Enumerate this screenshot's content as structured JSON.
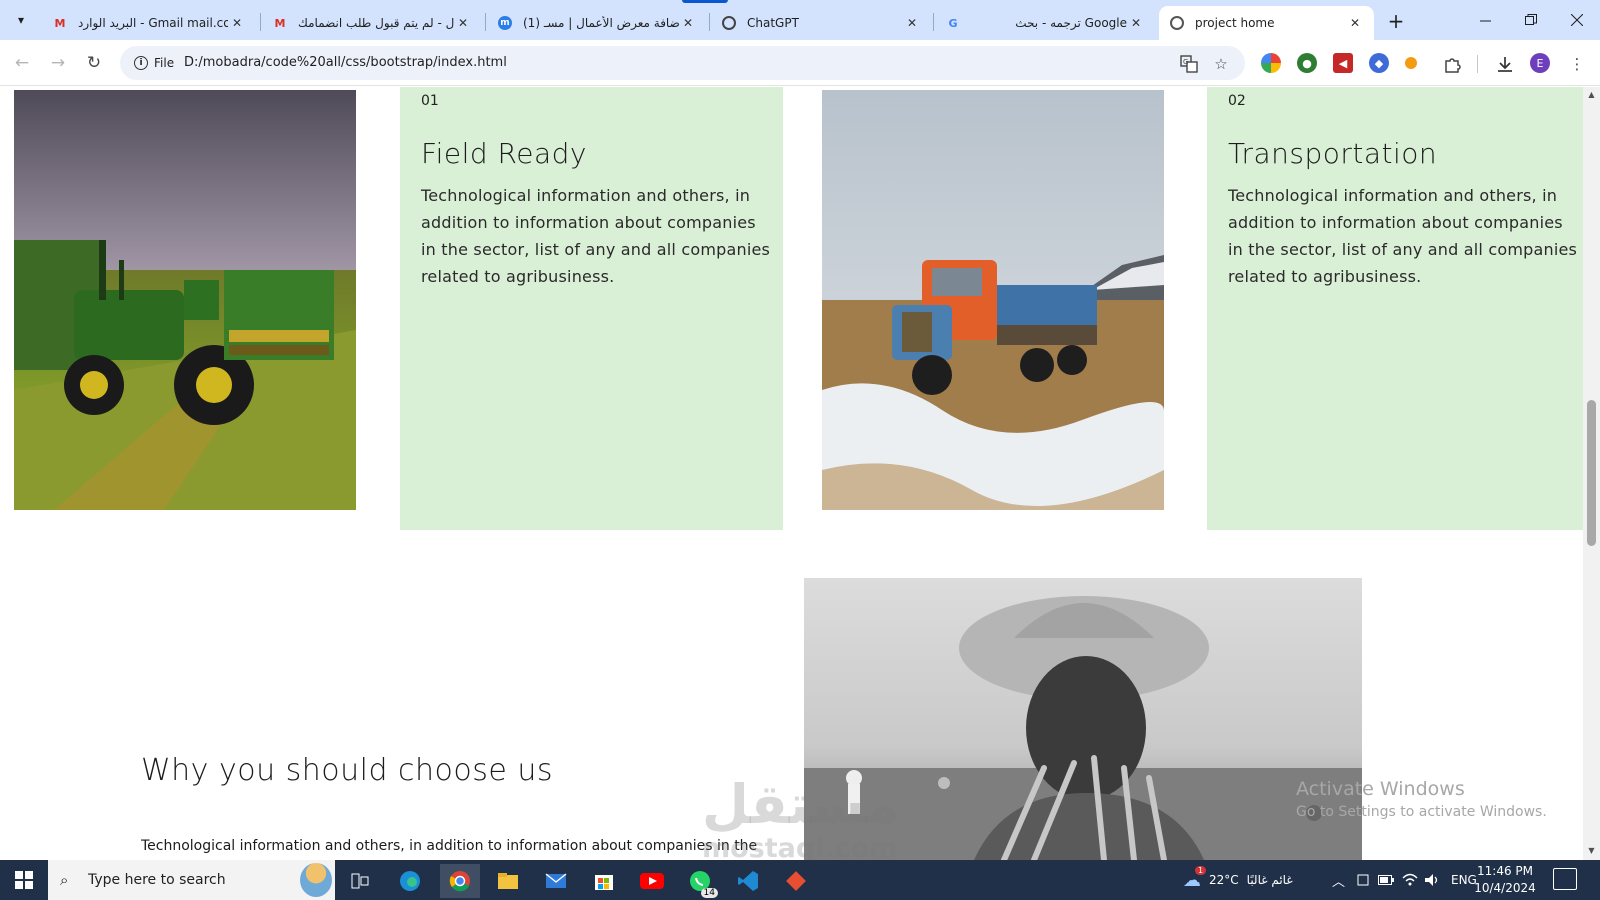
{
  "browser": {
    "tabs": [
      {
        "title": "البريد الوارد - Gmail ‎mail.com",
        "icon": "gmail-icon"
      },
      {
        "title": "لم يتم قبول طلب انضمامك - ‎ال",
        "icon": "gmail-icon"
      },
      {
        "title": "(1) إضافة معرض الأعمال | مسـ",
        "icon": "mostaql-icon"
      },
      {
        "title": "ChatGPT",
        "icon": "chatgpt-icon"
      },
      {
        "title": "ترجمه - بحث Google",
        "icon": "google-icon"
      },
      {
        "title": "project home",
        "icon": "globe-icon",
        "active": true
      }
    ],
    "close_glyph": "✕",
    "new_tab_glyph": "+",
    "address": {
      "chip_label": "File",
      "url": "D:/mobadra/code%20all/css/bootstrap/index.html"
    }
  },
  "page": {
    "cards": [
      {
        "number": "01",
        "title": "Field Ready",
        "text": "Technological information and others, in addition to information about companies in the sector, list of any and all companies related to agribusiness."
      },
      {
        "number": "02",
        "title": "Transportation",
        "text": "Technological information and others, in addition to information about companies in the sector, list of any and all companies related to agribusiness."
      }
    ],
    "why": {
      "title": "Why you should choose us",
      "text": "Technological information and others, in addition to information about companies in the"
    },
    "card_color": "#d9f0d6"
  },
  "overlay": {
    "activate_title": "Activate Windows",
    "activate_sub": "Go to Settings to activate Windows.",
    "watermark": "مستقل",
    "watermark_domain": "mostaql.com"
  },
  "taskbar": {
    "search_placeholder": "Type here to search",
    "weather_temp": "22°C",
    "weather_text": "غائم غالبًا",
    "weather_badge": "1",
    "language": "ENG",
    "time": "11:46 PM",
    "date": "10/4/2024",
    "whatsapp_badge": "14",
    "apps": [
      "task-view-icon",
      "edge-icon",
      "chrome-icon",
      "file-explorer-icon",
      "mail-icon",
      "store-icon",
      "youtube-icon",
      "whatsapp-icon",
      "vscode-icon",
      "git-icon"
    ]
  }
}
